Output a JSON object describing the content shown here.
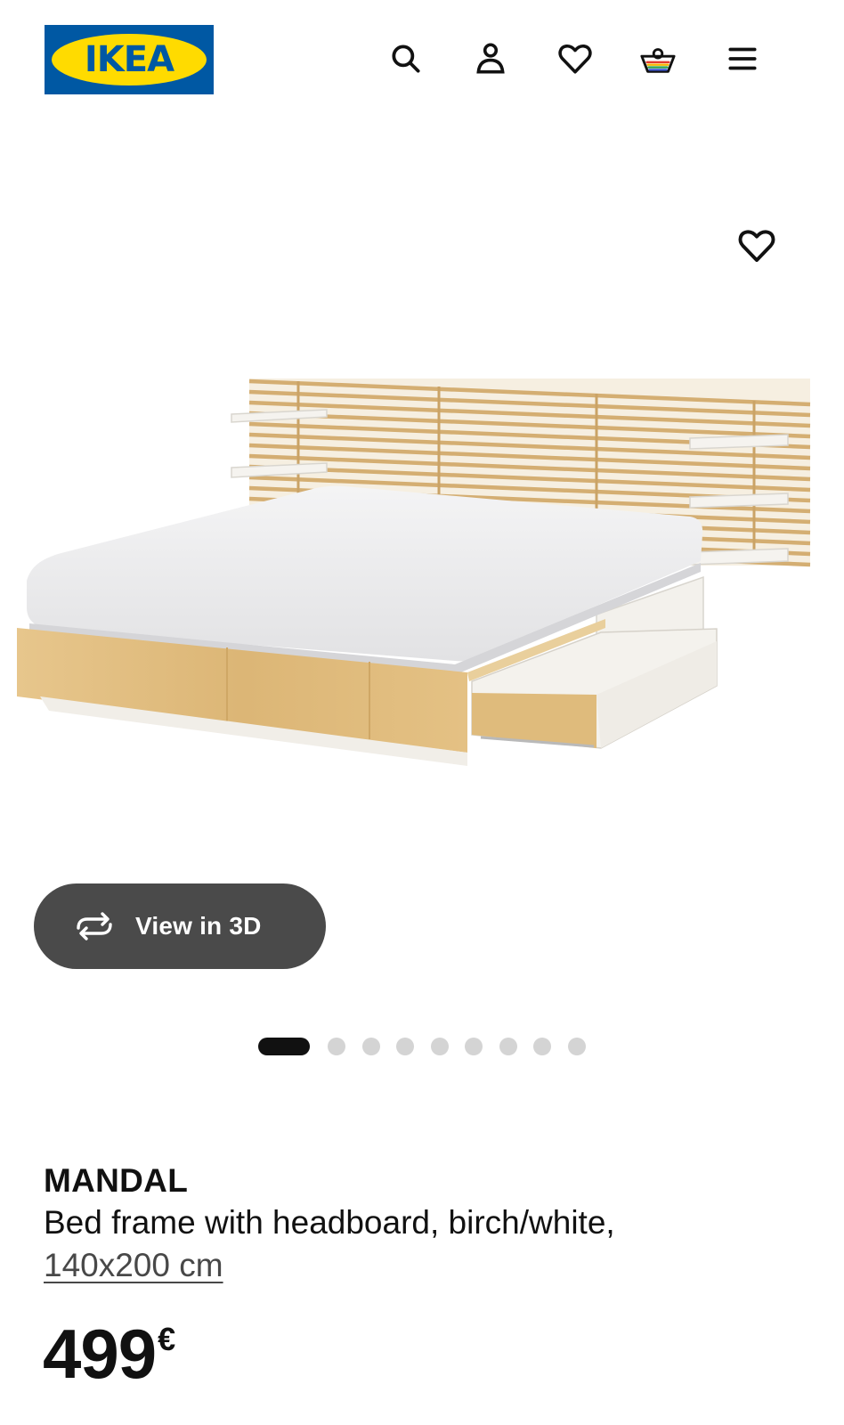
{
  "header": {
    "logo_text": "IKEA",
    "icons": [
      "search-icon",
      "profile-icon",
      "heart-icon",
      "basket-icon",
      "menu-icon"
    ]
  },
  "gallery": {
    "favorite_icon": "heart-icon",
    "view_3d_label": "View in 3D",
    "view_3d_icon": "rotate-icon",
    "dots_total": 9,
    "dots_active_index": 0
  },
  "product": {
    "name": "MANDAL",
    "description": "Bed frame with headboard, birch/white,",
    "size": "140x200 cm",
    "price_amount": "499",
    "price_currency": "€"
  },
  "colors": {
    "brand_blue": "#0058a3",
    "brand_yellow": "#ffdb00",
    "button_dark": "#4a4a4a",
    "dot_active": "#111111",
    "dot_inactive": "#d4d4d4"
  }
}
